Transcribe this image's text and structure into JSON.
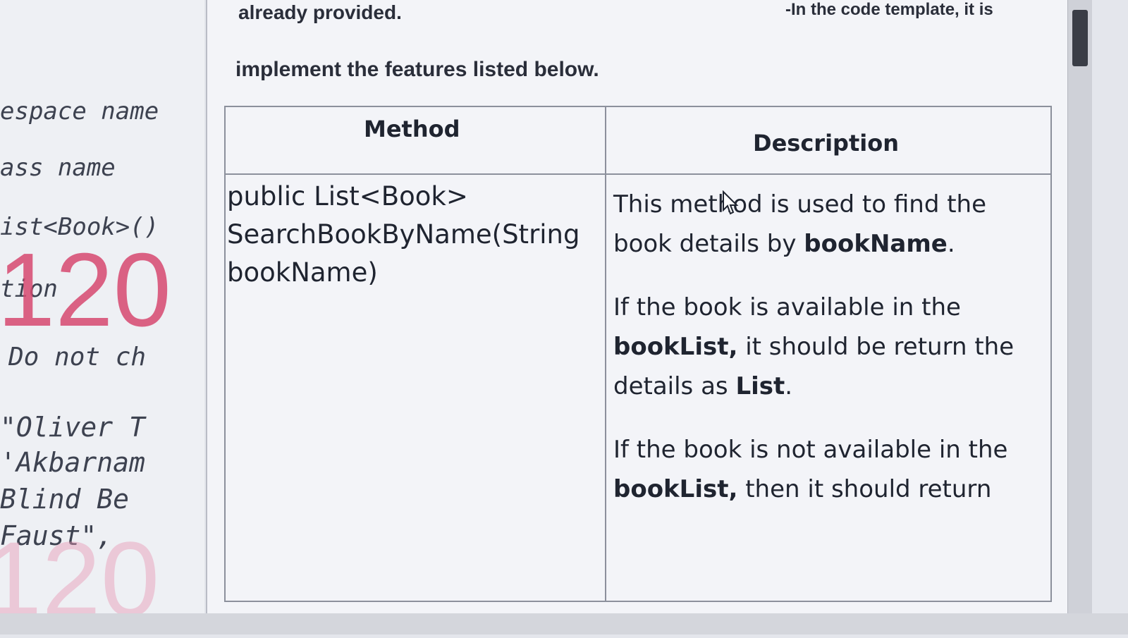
{
  "code_pane": {
    "lines": [
      "espace name",
      "ass name",
      "ist<Book>()",
      "tion",
      "Do not ch",
      "\"Oliver T",
      "'Akbarnam",
      "Blind Be",
      "Faust\","
    ],
    "watermark_top": "120",
    "watermark_bottom": "120"
  },
  "document": {
    "partial_intro": "already provided.",
    "partial_note": "-In the code template, it is",
    "instructions": "implement the features listed below.",
    "table": {
      "headers": [
        "Method",
        "Description"
      ],
      "rows": [
        {
          "method": "public List<Book> SearchBookByName(String bookName)",
          "description": {
            "p1_pre": "This method is used to find the book details by ",
            "p1_bold": "bookName",
            "p1_post": ".",
            "p2_pre": "If the book is available in the ",
            "p2_bold1": "bookList,",
            "p2_mid": " it should be return the details as ",
            "p2_bold2": "List",
            "p2_post": ".",
            "p3_pre": "If the book is not available in the ",
            "p3_bold": "bookList,",
            "p3_post": " then it should return"
          }
        }
      ]
    }
  },
  "colors": {
    "watermark_primary": "#d6486e",
    "scroll_thumb": "#3a3d46"
  },
  "icons": [
    "mouse-cursor-icon"
  ]
}
